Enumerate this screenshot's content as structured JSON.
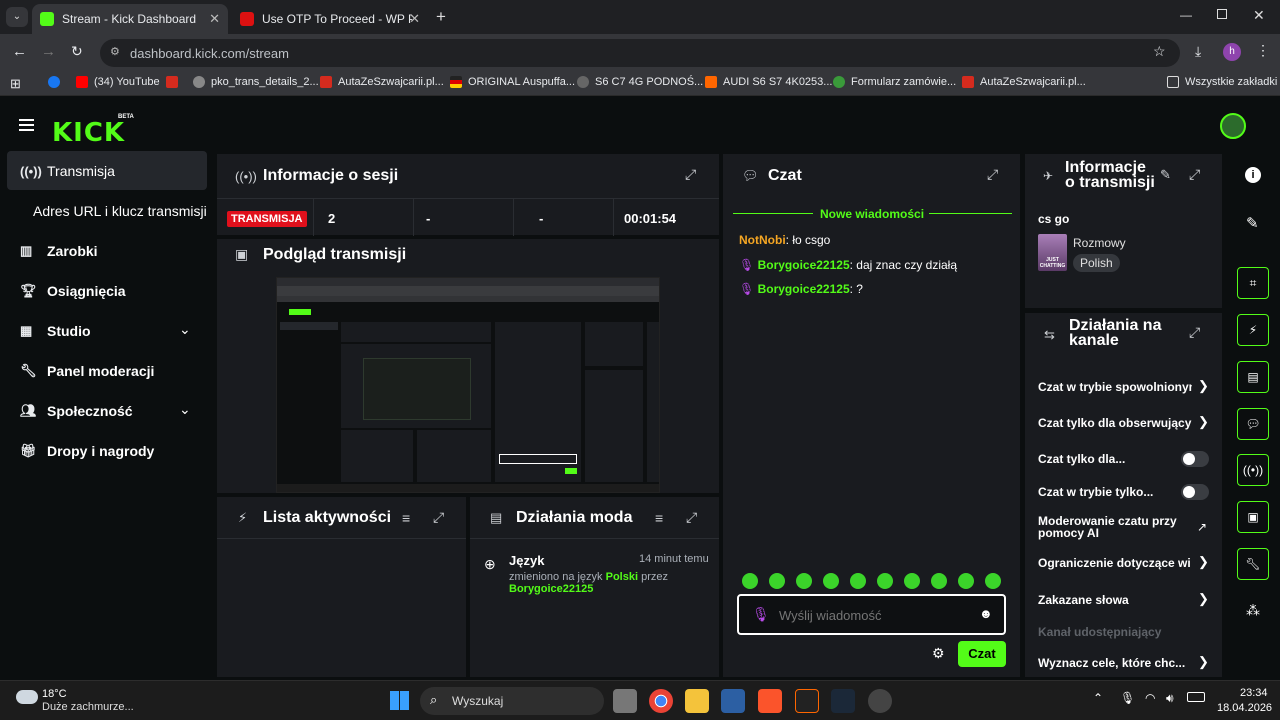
{
  "browser": {
    "tabs": [
      {
        "title": "Stream - Kick Dashboard",
        "active": true
      },
      {
        "title": "Use OTP To Proceed - WP Poczt",
        "active": false
      }
    ],
    "url": "dashboard.kick.com/stream",
    "bookmarks": [
      "(34) YouTube",
      "pko_trans_details_2...",
      "AutaZeSzwajcarii.pl...",
      "ORIGINAL Auspuffa...",
      "S6 C7 4G PODNOŚ...",
      "AUDI S6 S7 4K0253...",
      "Formularz zamówie...",
      "AutaZeSzwajcarii.pl..."
    ],
    "all_bookmarks": "Wszystkie zakładki",
    "profile_initial": "h"
  },
  "app": {
    "logo": "KICK",
    "logo_badge": "BETA"
  },
  "sidebar": {
    "items": [
      {
        "label": "Transmisja",
        "icon": "broadcast-icon"
      },
      {
        "label": "Adres URL i klucz transmisji"
      },
      {
        "label": "Zarobki",
        "icon": "chart-icon"
      },
      {
        "label": "Osiągnięcia",
        "icon": "trophy-icon"
      },
      {
        "label": "Studio",
        "icon": "studio-icon"
      },
      {
        "label": "Panel moderacji",
        "icon": "wrench-icon"
      },
      {
        "label": "Społeczność",
        "icon": "community-icon"
      },
      {
        "label": "Dropy i nagrody",
        "icon": "gift-icon"
      }
    ]
  },
  "session": {
    "title": "Informacje o sesji",
    "live_badge": "TRANSMISJA",
    "viewers": "2",
    "stat2": "-",
    "stat3": "-",
    "uptime": "00:01:54"
  },
  "preview": {
    "title": "Podgląd transmisji"
  },
  "activity": {
    "title": "Lista aktywności"
  },
  "modactions": {
    "title": "Działania moda",
    "entry": {
      "heading": "Język",
      "time": "14 minut temu",
      "text_prefix": "zmieniono na język ",
      "lang": "Polski",
      "text_mid": " przez",
      "user": "Borygoice22125"
    }
  },
  "chat": {
    "title": "Czat",
    "new_messages": "Nowe wiadomości",
    "messages": [
      {
        "user": "NotNobi",
        "text": ": ło csgo",
        "color": "#f5a623"
      },
      {
        "user": "Borygoice22125",
        "text": ": daj znac czy działą",
        "color": "#53fc18"
      },
      {
        "user": "Borygoice22125",
        "text": ": ?",
        "color": "#53fc18"
      }
    ],
    "placeholder": "Wyślij wiadomość",
    "send": "Czat"
  },
  "streaminfo": {
    "title_l1": "Informacje",
    "title_l2": "o transmisji",
    "stream_title": "cs go",
    "category": "Rozmowy",
    "language": "Polish",
    "thumb_text": "JUST CHATTING"
  },
  "channel_actions": {
    "title_l1": "Działania na",
    "title_l2": "kanale",
    "rows": [
      {
        "label": "Czat w trybie spowolnionym",
        "control": "chevron"
      },
      {
        "label": "Czat tylko dla obserwujący",
        "control": "chevron"
      },
      {
        "label": "Czat tylko dla...",
        "control": "toggle"
      },
      {
        "label": "Czat w trybie tylko...",
        "control": "toggle"
      },
      {
        "label": "Moderowanie czatu przy pomocy AI",
        "control": "external"
      },
      {
        "label": "Ograniczenie dotyczące wi",
        "control": "chevron"
      },
      {
        "label": "Zakazane słowa",
        "control": "chevron"
      },
      {
        "label": "Kanał udostępniający",
        "control": "none"
      },
      {
        "label": "Wyznacz cele, które chc...",
        "control": "chevron"
      }
    ]
  },
  "taskbar": {
    "temp": "18°C",
    "weather": "Duże zachmurze...",
    "search": "Wyszukaj",
    "time": "23:34",
    "date": "18.04.2026"
  },
  "colors": {
    "accent": "#53fc18",
    "live": "#e0101c",
    "panel": "#191b1f",
    "bg": "#0b0e0f"
  }
}
